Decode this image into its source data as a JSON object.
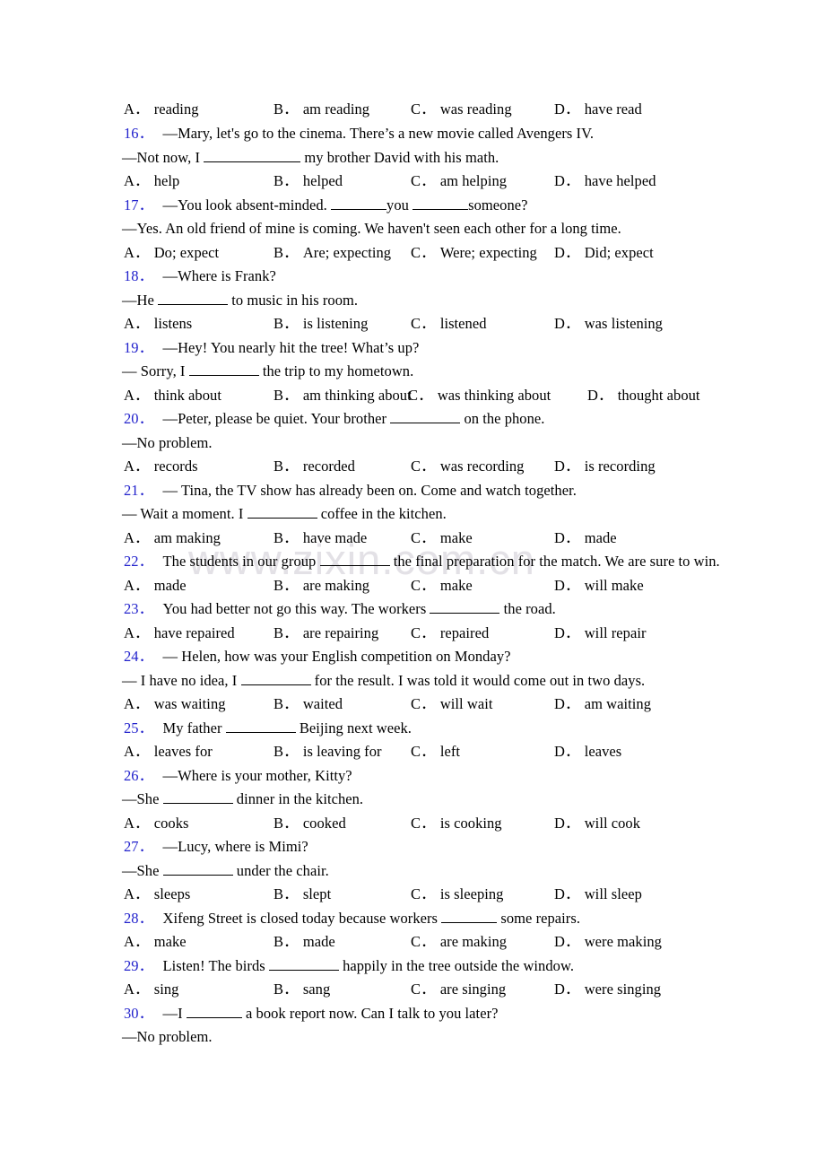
{
  "watermark": {
    "text": "www.zixin.com.cn"
  },
  "options_header": {
    "a": {
      "label": "A",
      "text": "reading"
    },
    "b": {
      "label": "B",
      "text": "am reading"
    },
    "c": {
      "label": "C",
      "text": "was reading"
    },
    "d": {
      "label": "D",
      "text": "have read"
    }
  },
  "questions": [
    {
      "number": "16",
      "stem": "—Mary, let's go to the cinema. There’s a new movie called Avengers IV.",
      "reply_pre": "—Not now, I ",
      "reply_post": " my brother David with his math.",
      "blank": "lg",
      "columns": "wide",
      "options": [
        {
          "label": "A",
          "text": "help"
        },
        {
          "label": "B",
          "text": "helped"
        },
        {
          "label": "C",
          "text": "am helping"
        },
        {
          "label": "D",
          "text": "have helped"
        }
      ]
    },
    {
      "number": "17",
      "stem_pre": "—You look absent-minded. ",
      "stem_mid": "you ",
      "stem_post": "someone?",
      "reply": "—Yes. An old friend of mine is coming. We haven't seen each other for a long time.",
      "columns": "wide",
      "options": [
        {
          "label": "A",
          "text": "Do; expect"
        },
        {
          "label": "B",
          "text": "Are; expecting"
        },
        {
          "label": "C",
          "text": "Were; expecting"
        },
        {
          "label": "D",
          "text": "Did; expect"
        }
      ]
    },
    {
      "number": "18",
      "stem": "—Where is Frank?",
      "reply_pre": "—He ",
      "reply_post": " to music in his room.",
      "blank": "md",
      "columns": "wide",
      "options": [
        {
          "label": "A",
          "text": "listens"
        },
        {
          "label": "B",
          "text": "is listening"
        },
        {
          "label": "C",
          "text": "listened"
        },
        {
          "label": "D",
          "text": "was listening"
        }
      ]
    },
    {
      "number": "19",
      "stem": "—Hey! You nearly hit the tree! What’s up?",
      "reply_pre": "— Sorry, I ",
      "reply_post": " the trip to my hometown.",
      "blank": "md",
      "columns": "tight",
      "options": [
        {
          "label": "A",
          "text": "think about"
        },
        {
          "label": "B",
          "text": "am thinking about"
        },
        {
          "label": "C",
          "text": "was thinking about"
        },
        {
          "label": "D",
          "text": "thought about"
        }
      ]
    },
    {
      "number": "20",
      "stem_pre": "—Peter, please be quiet. Your brother ",
      "stem_post": " on the phone.",
      "blank": "md",
      "reply": "—No problem.",
      "columns": "wide",
      "options": [
        {
          "label": "A",
          "text": "records"
        },
        {
          "label": "B",
          "text": "recorded"
        },
        {
          "label": "C",
          "text": "was recording"
        },
        {
          "label": "D",
          "text": "is recording"
        }
      ]
    },
    {
      "number": "21",
      "stem": "— Tina, the TV show has already been on. Come and watch together.",
      "reply_pre": "— Wait a moment. I ",
      "reply_post": " coffee in the kitchen.",
      "blank": "md",
      "columns": "wide",
      "options": [
        {
          "label": "A",
          "text": "am making"
        },
        {
          "label": "B",
          "text": "have made"
        },
        {
          "label": "C",
          "text": "make"
        },
        {
          "label": "D",
          "text": "made"
        }
      ]
    },
    {
      "number": "22",
      "stem_pre": "The students in our group ",
      "stem_post": " the final preparation for the match. We are sure to win.",
      "blank": "md",
      "columns": "wide",
      "options": [
        {
          "label": "A",
          "text": "made"
        },
        {
          "label": "B",
          "text": "are making"
        },
        {
          "label": "C",
          "text": "make"
        },
        {
          "label": "D",
          "text": "will make"
        }
      ]
    },
    {
      "number": "23",
      "stem_pre": "You had better not go this way. The workers ",
      "stem_post": " the road.",
      "blank": "md",
      "columns": "wide",
      "options": [
        {
          "label": "A",
          "text": "have repaired"
        },
        {
          "label": "B",
          "text": "are repairing"
        },
        {
          "label": "C",
          "text": "repaired"
        },
        {
          "label": "D",
          "text": "will repair"
        }
      ]
    },
    {
      "number": "24",
      "stem": "— Helen, how was your English competition on Monday?",
      "reply_pre": "— I have no idea, I ",
      "reply_post": " for the result. I was told it would come out in two days.",
      "blank": "md",
      "columns": "wide",
      "options": [
        {
          "label": "A",
          "text": "was waiting"
        },
        {
          "label": "B",
          "text": "waited"
        },
        {
          "label": "C",
          "text": "will wait"
        },
        {
          "label": "D",
          "text": "am waiting"
        }
      ]
    },
    {
      "number": "25",
      "stem_pre": "My father ",
      "stem_post": " Beijing next week.",
      "blank": "md",
      "columns": "wide",
      "options": [
        {
          "label": "A",
          "text": "leaves for"
        },
        {
          "label": "B",
          "text": "is leaving for"
        },
        {
          "label": "C",
          "text": "left"
        },
        {
          "label": "D",
          "text": "leaves"
        }
      ]
    },
    {
      "number": "26",
      "stem": "—Where is your mother, Kitty?",
      "reply_pre": "—She ",
      "reply_post": " dinner in the kitchen.",
      "blank": "md",
      "columns": "wide",
      "options": [
        {
          "label": "A",
          "text": "cooks"
        },
        {
          "label": "B",
          "text": "cooked"
        },
        {
          "label": "C",
          "text": "is cooking"
        },
        {
          "label": "D",
          "text": "will cook"
        }
      ]
    },
    {
      "number": "27",
      "stem": "—Lucy, where is Mimi?",
      "reply_pre": "—She ",
      "reply_post": " under the chair.",
      "blank": "md",
      "columns": "wide",
      "options": [
        {
          "label": "A",
          "text": "sleeps"
        },
        {
          "label": "B",
          "text": "slept"
        },
        {
          "label": "C",
          "text": "is sleeping"
        },
        {
          "label": "D",
          "text": "will sleep"
        }
      ]
    },
    {
      "number": "28",
      "stem_pre": "Xifeng Street is closed today because workers ",
      "stem_post": " some repairs.",
      "blank": "sm",
      "columns": "wide",
      "options": [
        {
          "label": "A",
          "text": "make"
        },
        {
          "label": "B",
          "text": "made"
        },
        {
          "label": "C",
          "text": "are making"
        },
        {
          "label": "D",
          "text": "were making"
        }
      ]
    },
    {
      "number": "29",
      "stem_pre": "Listen! The birds ",
      "stem_post": " happily in the tree outside the window.",
      "blank": "md",
      "columns": "wide",
      "options": [
        {
          "label": "A",
          "text": "sing"
        },
        {
          "label": "B",
          "text": "sang"
        },
        {
          "label": "C",
          "text": "are singing"
        },
        {
          "label": "D",
          "text": "were singing"
        }
      ]
    },
    {
      "number": "30",
      "stem_pre": "—I ",
      "stem_post": " a book report now. Can I talk to you later?",
      "blank": "sm",
      "reply": "—No problem."
    }
  ]
}
